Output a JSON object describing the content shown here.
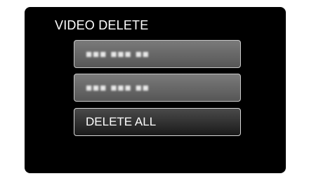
{
  "screen": {
    "title": "VIDEO DELETE",
    "options": [
      {
        "kind": "date",
        "text": "■■■ ■■■ ■■"
      },
      {
        "kind": "date",
        "text": "■■■ ■■■ ■■"
      },
      {
        "kind": "action",
        "text": "DELETE ALL"
      }
    ],
    "selected_index": 2
  },
  "colors": {
    "screen_bg": "#000000",
    "text": "#ffffff",
    "inactive_button": "#6a6a6a",
    "active_button": "#2a2a2a"
  }
}
